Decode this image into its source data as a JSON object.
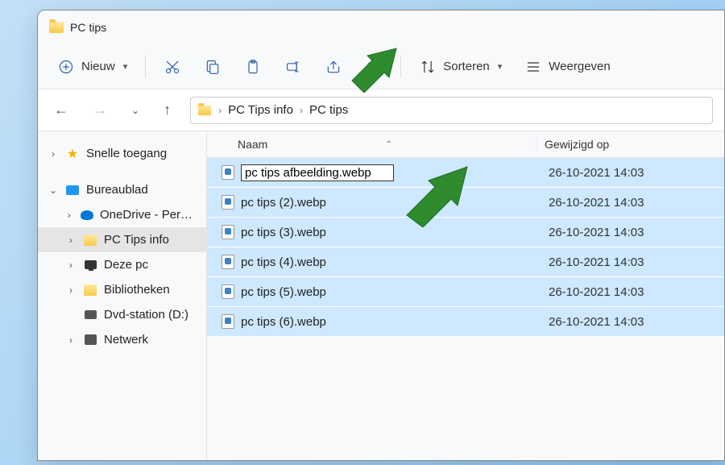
{
  "titlebar": {
    "title": "PC tips"
  },
  "toolbar": {
    "new_label": "Nieuw",
    "sort_label": "Sorteren",
    "view_label": "Weergeven"
  },
  "breadcrumb": {
    "parent": "PC Tips info",
    "current": "PC tips"
  },
  "sidebar": {
    "quick_access": "Snelle toegang",
    "desktop": "Bureaublad",
    "onedrive": "OneDrive - Persona…",
    "pc_tips_info": "PC Tips info",
    "this_pc": "Deze pc",
    "libraries": "Bibliotheken",
    "dvd": "Dvd-station (D:)",
    "network": "Netwerk"
  },
  "columns": {
    "name": "Naam",
    "modified": "Gewijzigd op"
  },
  "rename_value": "pc tips afbeelding.webp",
  "files": [
    {
      "name": "pc tips afbeelding.webp",
      "date": "26-10-2021 14:03",
      "renaming": true
    },
    {
      "name": "pc tips (2).webp",
      "date": "26-10-2021 14:03"
    },
    {
      "name": "pc tips (3).webp",
      "date": "26-10-2021 14:03"
    },
    {
      "name": "pc tips (4).webp",
      "date": "26-10-2021 14:03"
    },
    {
      "name": "pc tips (5).webp",
      "date": "26-10-2021 14:03"
    },
    {
      "name": "pc tips (6).webp",
      "date": "26-10-2021 14:03"
    }
  ]
}
